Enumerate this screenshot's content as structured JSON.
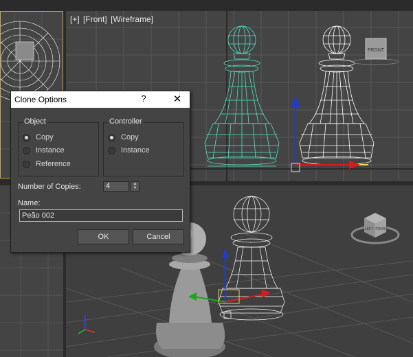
{
  "viewports": {
    "front": {
      "label": [
        "[+]",
        "[Front]",
        "[Wireframe]"
      ],
      "viewcube": "FRONT"
    },
    "perspective": {
      "viewcube_faces": [
        "LEFT",
        "FRONT"
      ]
    }
  },
  "dialog": {
    "title": "Clone Options",
    "help_label": "?",
    "close_label": "✕",
    "object_group": {
      "title": "Object",
      "options": [
        {
          "label": "Copy",
          "selected": true
        },
        {
          "label": "Instance",
          "selected": false
        },
        {
          "label": "Reference",
          "selected": false
        }
      ]
    },
    "controller_group": {
      "title": "Controller",
      "options": [
        {
          "label": "Copy",
          "selected": true
        },
        {
          "label": "Instance",
          "selected": false
        }
      ]
    },
    "copies_label": "Number of Copies:",
    "copies_value": "4",
    "spinner_up": "▲",
    "spinner_down": "▼",
    "name_label": "Name:",
    "name_value": "Peão 002",
    "ok_label": "OK",
    "cancel_label": "Cancel"
  },
  "colors": {
    "selected_wire": "#4fe3c2",
    "wire": "#ffffff",
    "viewport_bg": "#444444",
    "active_border": "#c8a84a"
  }
}
